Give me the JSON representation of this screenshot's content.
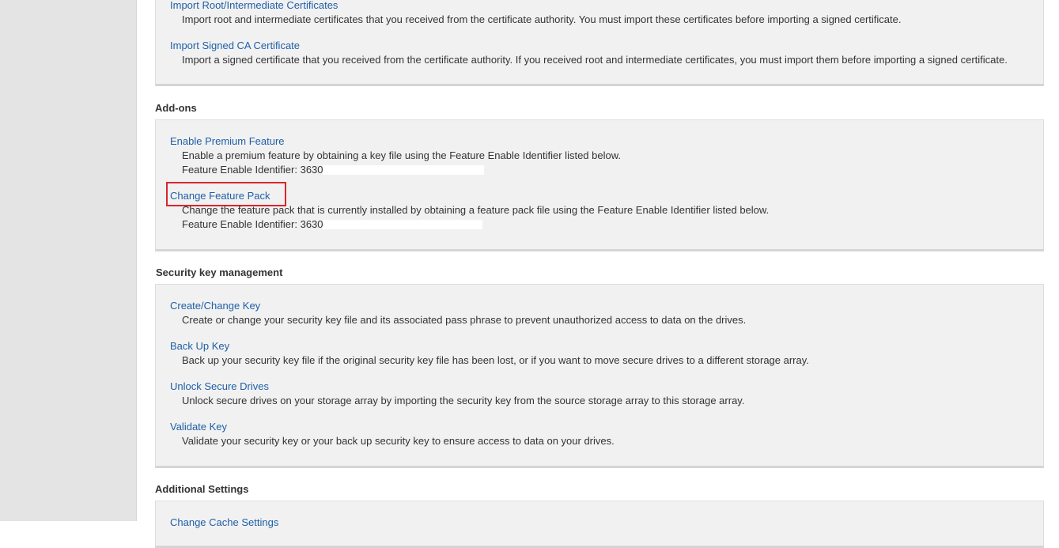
{
  "certificates": {
    "items": [
      {
        "label": "Import Root/Intermediate Certificates",
        "description": "Import root and intermediate certificates that you received from the certificate authority. You must import these certificates before importing a signed certificate."
      },
      {
        "label": "Import Signed CA Certificate",
        "description": "Import a signed certificate that you received from the certificate authority. If you received root and intermediate certificates, you must import them before importing a signed certificate."
      }
    ]
  },
  "addons": {
    "heading": "Add-ons",
    "items": [
      {
        "label": "Enable Premium Feature",
        "description": "Enable a premium feature by obtaining a key file using the Feature Enable Identifier listed below.",
        "identifier": "Feature Enable Identifier: 3630"
      },
      {
        "label": "Change Feature Pack",
        "description": "Change the feature pack that is currently installed by obtaining a feature pack file using the Feature Enable Identifier listed below.",
        "identifier": "Feature Enable Identifier: 3630"
      }
    ]
  },
  "security": {
    "heading": "Security key management",
    "items": [
      {
        "label": "Create/Change Key",
        "description": "Create or change your security key file and its associated pass phrase to prevent unauthorized access to data on the drives."
      },
      {
        "label": "Back Up Key",
        "description": "Back up your security key file if the original security key file has been lost, or if you want to move secure drives to a different storage array."
      },
      {
        "label": "Unlock Secure Drives",
        "description": "Unlock secure drives on your storage array by importing the security key from the source storage array to this storage array."
      },
      {
        "label": "Validate Key",
        "description": "Validate your security key or your back up security key to ensure access to data on your drives."
      }
    ]
  },
  "additional": {
    "heading": "Additional Settings",
    "items": [
      {
        "label": "Change Cache Settings"
      }
    ]
  },
  "colors": {
    "link": "#1f5fa8",
    "panel_bg": "#f1f1f1",
    "highlight": "#d9262d",
    "rail": "#e4e4e4"
  }
}
